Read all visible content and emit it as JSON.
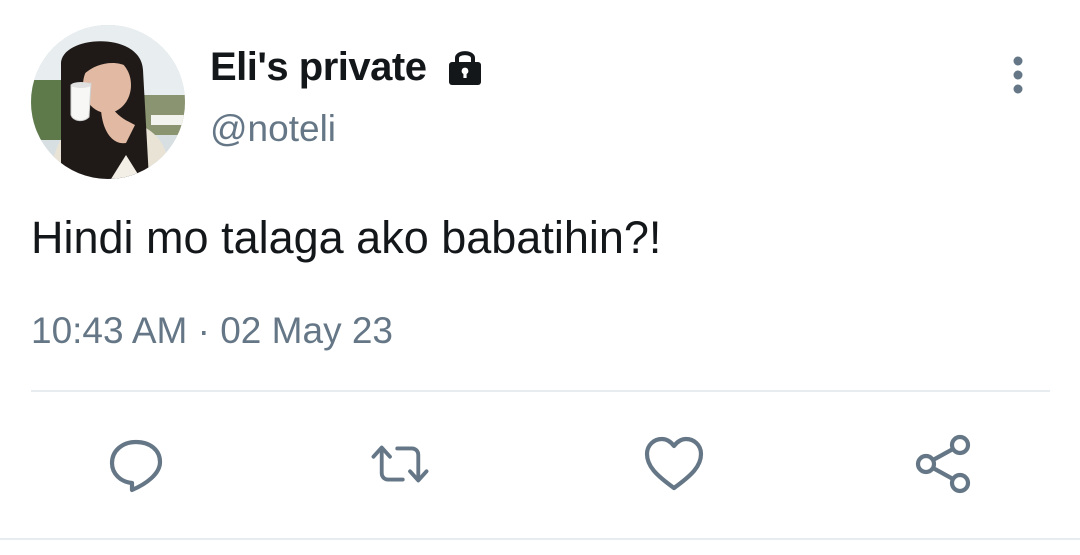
{
  "tweet": {
    "display_name": "Eli's private",
    "handle": "@noteli",
    "text": "Hindi mo talaga ako babatihin?!",
    "time": "10:43 AM",
    "separator": "·",
    "date": "02 May 23"
  },
  "icons": {
    "lock": "lock-icon",
    "more": "more-vertical-icon",
    "reply": "reply-icon",
    "retweet": "retweet-icon",
    "like": "heart-icon",
    "share": "share-icon"
  },
  "colors": {
    "text_primary": "#14171a",
    "text_secondary": "#657786",
    "icon": "#657786",
    "divider": "#e6ecf0"
  }
}
